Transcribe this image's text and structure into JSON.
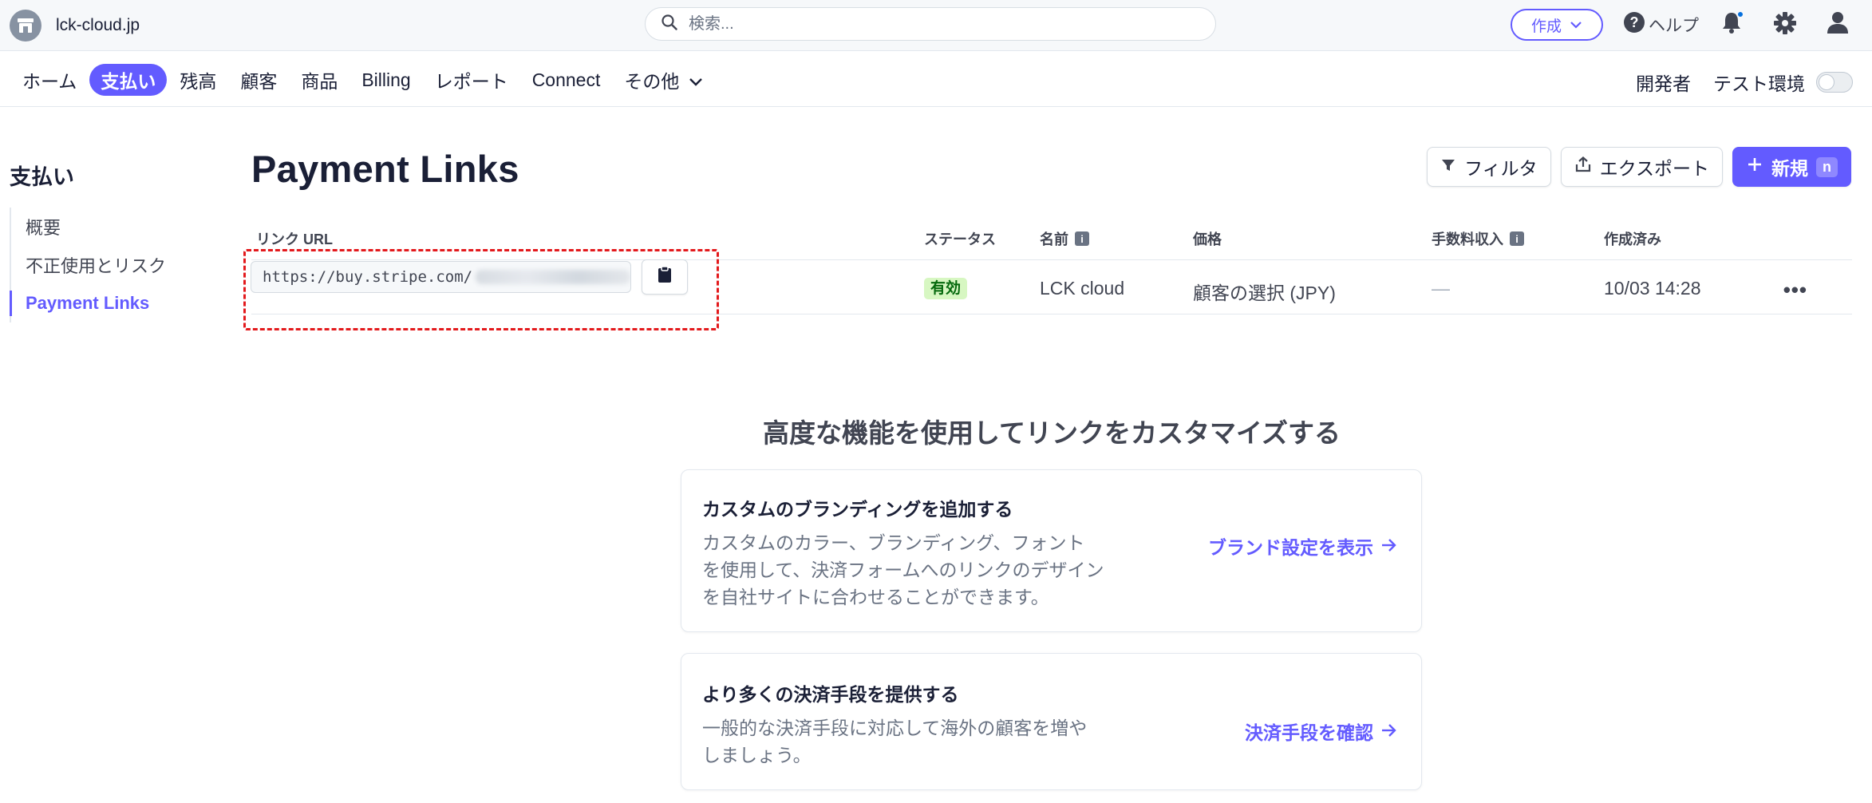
{
  "topbar": {
    "account_name": "lck-cloud.jp",
    "search_placeholder": "検索...",
    "create_label": "作成",
    "help_label": "ヘルプ"
  },
  "nav": {
    "items": [
      "ホーム",
      "支払い",
      "残高",
      "顧客",
      "商品",
      "Billing",
      "レポート",
      "Connect",
      "その他"
    ],
    "active_index": 1,
    "developers_label": "開発者",
    "test_mode_label": "テスト環境",
    "test_mode_on": false
  },
  "sidebar": {
    "title": "支払い",
    "items": [
      "概要",
      "不正使用とリスク",
      "Payment Links"
    ],
    "active_index": 2
  },
  "main": {
    "title": "Payment Links",
    "filter_label": "フィルタ",
    "export_label": "エクスポート",
    "new_label": "新規",
    "new_shortcut": "n"
  },
  "table": {
    "columns": {
      "url": "リンク URL",
      "status": "ステータス",
      "name": "名前",
      "price": "価格",
      "fee": "手数料収入",
      "created": "作成済み"
    },
    "rows": [
      {
        "url": "https://buy.stripe.com/",
        "status": "有効",
        "name": "LCK cloud",
        "price": "顧客の選択 (JPY)",
        "fee": "—",
        "created": "10/03 14:28"
      }
    ]
  },
  "customize": {
    "title": "高度な機能を使用してリンクをカスタマイズする",
    "cards": [
      {
        "title": "カスタムのブランディングを追加する",
        "lines": [
          "カスタムのカラー、ブランディング、フォント",
          "を使用して、決済フォームへのリンクのデザイン",
          "を自社サイトに合わせることができます。"
        ],
        "link": "ブランド設定を表示"
      },
      {
        "title": "より多くの決済手段を提供する",
        "lines": [
          "一般的な決済手段に対応して海外の顧客を増や",
          "しましょう。"
        ],
        "link": "決済手段を確認"
      }
    ]
  },
  "colors": {
    "accent": "#635bff",
    "status_green_bg": "#d7f7c2",
    "status_green_text": "#05690d",
    "highlight_dashed": "#e3191c"
  },
  "icons": [
    "store-icon",
    "search-icon",
    "chevron-down-icon",
    "help-icon",
    "bell-icon",
    "gear-icon",
    "user-icon",
    "filter-icon",
    "export-icon",
    "plus-icon",
    "clipboard-icon",
    "info-icon",
    "more-icon",
    "arrow-right-icon"
  ]
}
